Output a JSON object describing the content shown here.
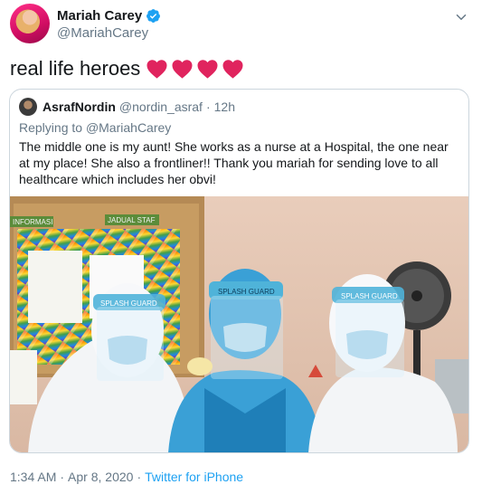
{
  "author": {
    "name": "Mariah Carey",
    "handle": "@MariahCarey"
  },
  "tweet": {
    "text": "real life heroes",
    "emoji": [
      "red-heart",
      "red-heart",
      "red-heart",
      "red-heart"
    ]
  },
  "quoted": {
    "name": "AsrafNordin",
    "handle": "@nordin_asraf",
    "separator": "·",
    "time": "12h",
    "replying_prefix": "Replying to",
    "replying_to": "@MariahCarey",
    "body": "The middle one is my aunt! She works as a nurse at a Hospital, the one near at my place! She also a frontliner!! Thank you mariah for sending love to all healthcare which includes her obvi!",
    "photo": {
      "board_labels": [
        "INFORMASI",
        "JADUAL STAF"
      ],
      "visor_texts": [
        "SPLASH GUARD",
        "SPLASH GUARD",
        "SPLASH GUARD"
      ]
    }
  },
  "footer": {
    "time": "1:34 AM",
    "separator": "·",
    "date": "Apr 8, 2020",
    "source": "Twitter for iPhone"
  },
  "colors": {
    "link": "#1da1f2",
    "muted": "#657786",
    "verified": "#1da1f2",
    "heart": "#e0245e"
  }
}
